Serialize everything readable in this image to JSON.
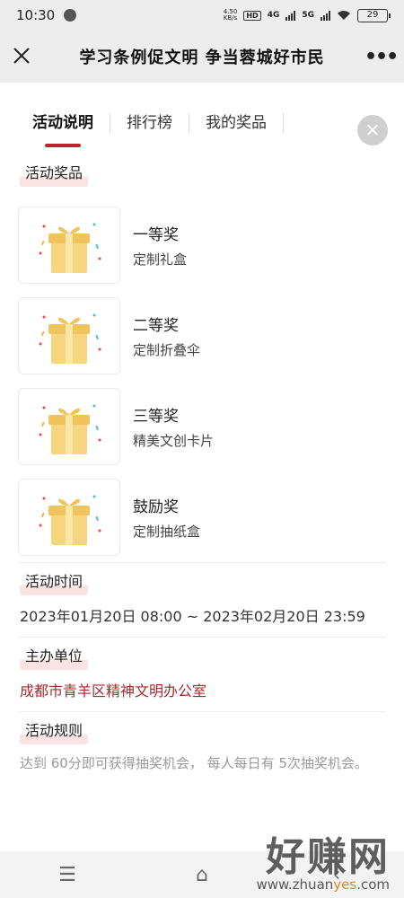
{
  "status_bar": {
    "time": "10:30",
    "net_speed_top": "4.50",
    "net_speed_bottom": "KB/s",
    "hd_tag": "HD",
    "sig1": "4G",
    "sig2": "5G",
    "battery": "29"
  },
  "title_bar": {
    "title": "学习条例促文明  争当蓉城好市民",
    "more_label": "•••"
  },
  "tabs": [
    {
      "label": "活动说明",
      "active": true
    },
    {
      "label": "排行榜",
      "active": false
    },
    {
      "label": "我的奖品",
      "active": false
    }
  ],
  "prizes_section": {
    "label": "活动奖品"
  },
  "prizes": [
    {
      "rank": "一等奖",
      "desc": "定制礼盒",
      "icon": "gift-box-icon"
    },
    {
      "rank": "二等奖",
      "desc": "定制折叠伞",
      "icon": "gift-box-icon"
    },
    {
      "rank": "三等奖",
      "desc": "精美文创卡片",
      "icon": "gift-box-icon"
    },
    {
      "rank": "鼓励奖",
      "desc": "定制抽纸盒",
      "icon": "gift-box-icon"
    }
  ],
  "time_section": {
    "label": "活动时间",
    "value": "2023年01月20日 08:00 ~ 2023年02月20日 23:59"
  },
  "host_section": {
    "label": "主办单位",
    "value": "成都市青羊区精神文明办公室"
  },
  "rules_section": {
    "label": "活动规则",
    "value": "达到 60分即可获得抽奖机会，  每人每日有 5次抽奖机会。"
  },
  "watermark": {
    "big": "好赚网",
    "small_a": "www.zhuan",
    "small_b": "yes",
    "small_c": ".com"
  },
  "colors": {
    "accent": "#c0242b",
    "host_text": "#a8282c",
    "label_bg": "#fbe3e3"
  }
}
